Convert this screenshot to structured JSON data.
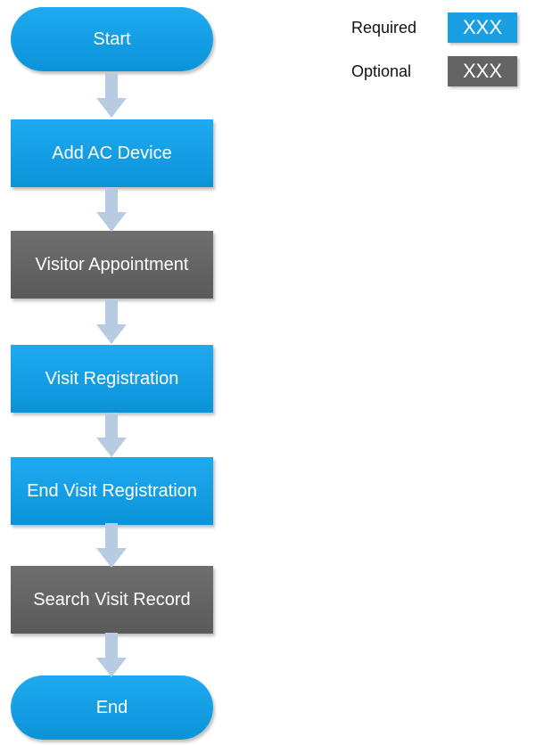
{
  "flow": {
    "nodes": [
      {
        "label": "Start",
        "kind": "terminal",
        "status": "required"
      },
      {
        "label": "Add AC Device",
        "kind": "step",
        "status": "required"
      },
      {
        "label": "Visitor Appointment",
        "kind": "step",
        "status": "optional"
      },
      {
        "label": "Visit Registration",
        "kind": "step",
        "status": "required"
      },
      {
        "label": "End Visit Registration",
        "kind": "step",
        "status": "required"
      },
      {
        "label": "Search Visit Record",
        "kind": "step",
        "status": "optional"
      },
      {
        "label": "End",
        "kind": "terminal",
        "status": "required"
      }
    ]
  },
  "legend": {
    "required": {
      "label": "Required",
      "swatch_text": "XXX",
      "color": "#1a9fe3"
    },
    "optional": {
      "label": "Optional",
      "swatch_text": "XXX",
      "color": "#636363"
    }
  },
  "colors": {
    "arrow": "#b7cbe2",
    "required": "#1a9fe3",
    "optional": "#636363"
  }
}
